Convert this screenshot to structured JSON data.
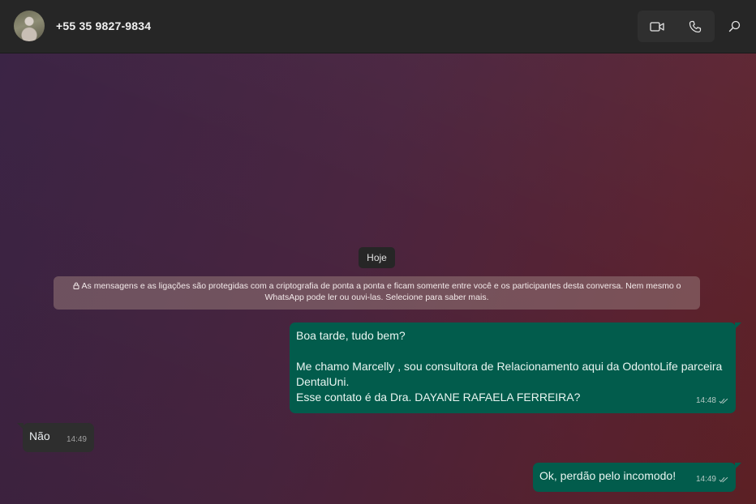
{
  "header": {
    "contact_name": "+55 35 9827-9834",
    "avatar_icon": "contact-photo",
    "video_icon": "video-camera-icon",
    "call_icon": "phone-icon",
    "search_icon": "search-icon"
  },
  "chat": {
    "date_label": "Hoje",
    "encryption_notice": "As mensagens e as ligações são protegidas com a criptografia de ponta a ponta e ficam somente entre você e os participantes desta conversa. Nem mesmo o WhatsApp pode ler ou ouvi-las. Selecione para saber mais.",
    "messages": [
      {
        "direction": "outgoing",
        "text": "Boa tarde, tudo bem?\n\nMe chamo Marcelly , sou consultora de Relacionamento aqui da OdontoLife parceira DentalUni.\nEsse contato é da Dra. DAYANE RAFAELA FERREIRA?",
        "time": "14:48",
        "status": "read"
      },
      {
        "direction": "incoming",
        "text": "Não",
        "time": "14:49"
      },
      {
        "direction": "outgoing",
        "text": "Ok, perdão pelo incomodo!",
        "time": "14:49",
        "status": "read"
      }
    ]
  },
  "colors": {
    "outgoing_bubble": "#025c4c",
    "incoming_bubble": "#2e2e2e",
    "header_bg": "#262626"
  }
}
